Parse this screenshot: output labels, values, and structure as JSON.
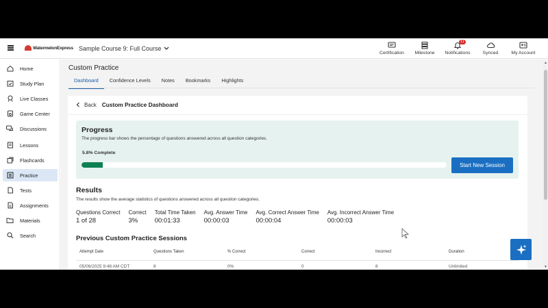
{
  "header": {
    "brand": "WatermelonExpress",
    "course": "Sample Course 9: Full Course",
    "actions": [
      {
        "label": "Certification",
        "icon": "certification-icon"
      },
      {
        "label": "Milestone",
        "icon": "milestone-icon"
      },
      {
        "label": "Notifications",
        "icon": "bell-icon",
        "badge": "11"
      },
      {
        "label": "Synced",
        "icon": "cloud-icon"
      },
      {
        "label": "My Account",
        "icon": "account-icon"
      }
    ]
  },
  "sidebar": {
    "items": [
      {
        "label": "Home",
        "icon": "home-icon"
      },
      {
        "label": "Study Plan",
        "icon": "calendar-check-icon"
      },
      {
        "label": "Live Classes",
        "icon": "live-icon"
      },
      {
        "label": "Game Center",
        "icon": "game-icon"
      },
      {
        "label": "Discussions",
        "icon": "chat-icon"
      },
      {
        "label": "Lessons",
        "icon": "lessons-icon"
      },
      {
        "label": "Flashcards",
        "icon": "flashcards-icon"
      },
      {
        "label": "Practice",
        "icon": "practice-icon",
        "active": true
      },
      {
        "label": "Tests",
        "icon": "tests-icon"
      },
      {
        "label": "Assignments",
        "icon": "assignments-icon"
      },
      {
        "label": "Materials",
        "icon": "folder-icon"
      },
      {
        "label": "Search",
        "icon": "search-icon"
      }
    ]
  },
  "main": {
    "title": "Custom Practice",
    "tabs": [
      {
        "label": "Dashboard",
        "active": true
      },
      {
        "label": "Confidence Levels"
      },
      {
        "label": "Notes"
      },
      {
        "label": "Bookmarks"
      },
      {
        "label": "Highlights"
      }
    ],
    "back_label": "Back",
    "dashboard_title": "Custom Practice Dashboard",
    "progress": {
      "title": "Progress",
      "description": "The progress bar shows the percentage of questions answered across all question categories.",
      "percent_label": "5.8% Complete",
      "percent": 5.8,
      "button": "Start New Session"
    },
    "results": {
      "title": "Results",
      "description": "The results show the average statistics of questions answered across all question categories.",
      "stats": [
        {
          "label": "Questions Correct",
          "value": "1 of 28"
        },
        {
          "label": "Correct",
          "value": "3%"
        },
        {
          "label": "Total Time Taken",
          "value": "00:01:33"
        },
        {
          "label": "Avg. Answer Time",
          "value": "00:00:03"
        },
        {
          "label": "Avg. Correct Answer Time",
          "value": "00:00:04"
        },
        {
          "label": "Avg. Incorrect Answer Time",
          "value": "00:00:03"
        }
      ]
    },
    "sessions": {
      "title": "Previous Custom Practice Sessions",
      "columns": [
        "Attempt Date",
        "Questions Taken",
        "% Correct",
        "Correct",
        "Incorrect",
        "Duration"
      ],
      "rows": [
        [
          "05/06/2025 9:48 AM CDT",
          "8",
          "0%",
          "0",
          "8",
          "Unlimited"
        ]
      ]
    }
  },
  "colors": {
    "accent": "#1b6fc2",
    "progress_fill": "#0e8153",
    "progress_bg": "#e6f2ef",
    "active_nav": "#dbe7f5"
  }
}
